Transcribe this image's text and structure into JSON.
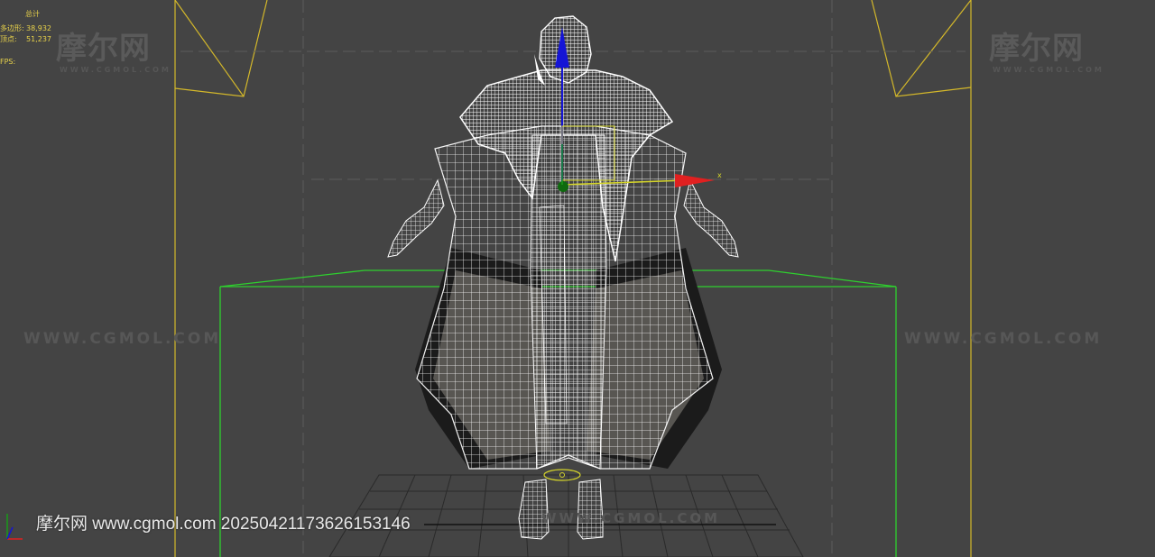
{
  "stats": {
    "title": "总计",
    "polygons_label": "多边形:",
    "polygons_value": "38,932",
    "vertices_label": "顶点:",
    "vertices_value": "51,237",
    "fps_label": "FPS:"
  },
  "watermarks": {
    "logo_text": "摩尔网",
    "logo_sub": "WWW.CGMOL.COM",
    "url_text": "WWW.CGMOL.COM"
  },
  "gizmo": {
    "x_axis_label": "x"
  },
  "stamp_text": "摩尔网 www.cgmol.com 20250421173626153146",
  "colors": {
    "background": "#444444",
    "camera_frame": "#d4b82a",
    "bounding_box": "#2ed12e",
    "wireframe": "#ffffff",
    "stats_text": "#e8d24a",
    "gizmo_x": "#e02020",
    "gizmo_y": "#1a9a1a",
    "gizmo_z": "#1515d6"
  }
}
